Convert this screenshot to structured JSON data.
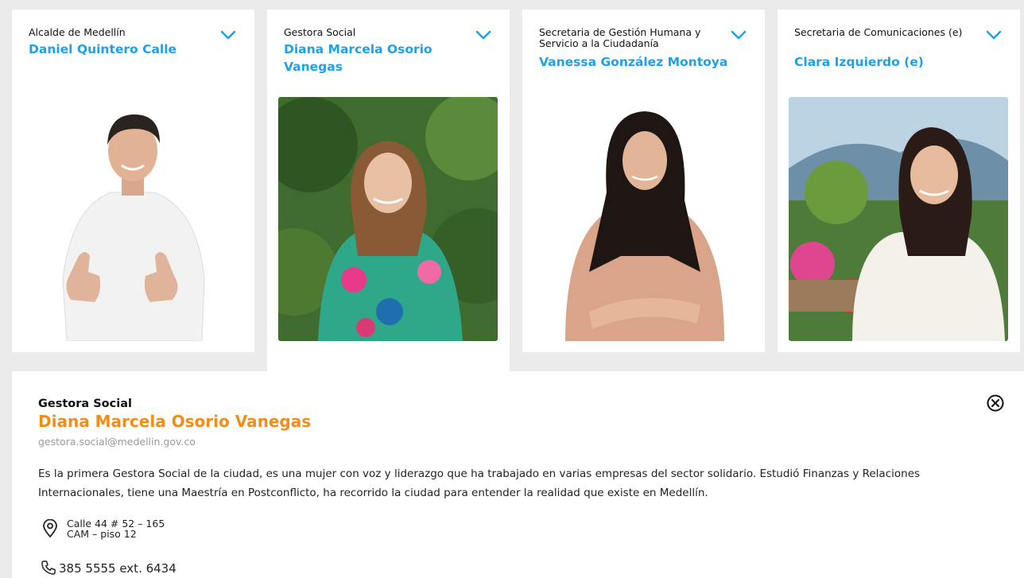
{
  "cards": [
    {
      "role": "Alcalde de Medellín",
      "name": "Daniel Quintero Calle",
      "photo": "man-thumbs-up"
    },
    {
      "role": "Gestora Social",
      "name": "Diana Marcela Osorio Vanegas",
      "photo": "woman-garden"
    },
    {
      "role": "Secretaria de Gestión Humana y Servicio a la Ciudadanía",
      "name": "Vanessa González Montoya",
      "photo": "woman-arms-crossed"
    },
    {
      "role": "Secretaria de Comunicaciones (e)",
      "name": "Clara Izquierdo (e)",
      "photo": "woman-mountains"
    }
  ],
  "detail": {
    "role": "Gestora Social",
    "name": "Diana Marcela Osorio Vanegas",
    "email": "gestora.social@medellin.gov.co",
    "bio": "Es la primera Gestora Social de la ciudad, es una mujer con voz y liderazgo que ha trabajado en varias empresas del sector solidario. Estudió Finanzas y Relaciones Internacionales, tiene una Maestría en Postconflicto, ha recorrido la ciudad para entender la realidad que existe en Medellín.",
    "address_line1": "Calle 44 # 52 – 165",
    "address_line2": "CAM – piso 12",
    "phone": "385 5555 ext. 6434"
  },
  "colors": {
    "accent_blue": "#1da1e8",
    "accent_orange": "#f28c1c",
    "background": "#ebebeb"
  },
  "icons": [
    "chevron-down-icon",
    "close-icon",
    "location-pin-icon",
    "phone-icon"
  ]
}
